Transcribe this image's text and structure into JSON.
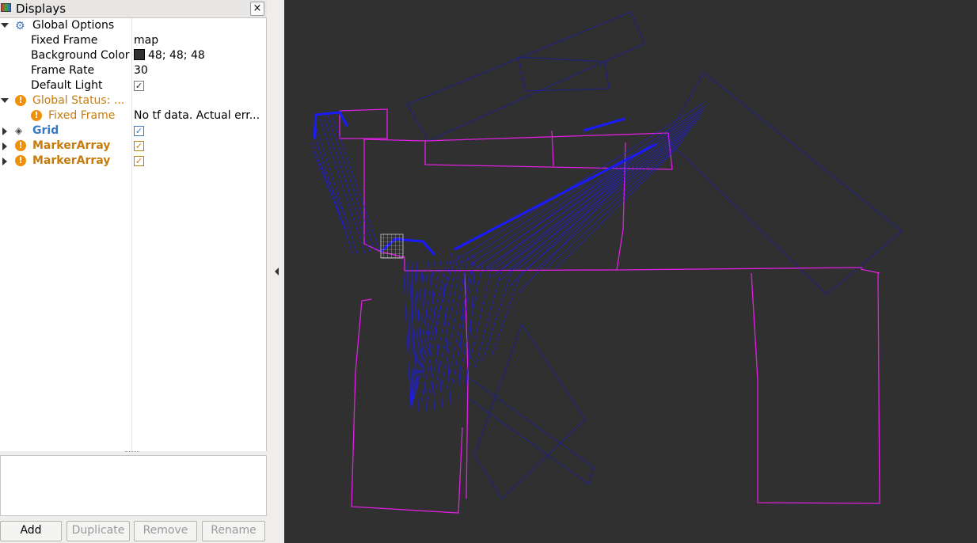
{
  "window": {
    "title": "Displays",
    "close_label": "×"
  },
  "tree": {
    "global_options": {
      "label": "Global Options",
      "icon": "gear-icon"
    },
    "fixed_frame": {
      "label": "Fixed Frame",
      "value": "map"
    },
    "background_color": {
      "label": "Background Color",
      "value": "48; 48; 48",
      "color": "#303030"
    },
    "frame_rate": {
      "label": "Frame Rate",
      "value": "30"
    },
    "default_light": {
      "label": "Default Light",
      "checked": "✓"
    },
    "global_status": {
      "label": "Global Status: ...",
      "icon": "warning-icon"
    },
    "status_fixed_frame": {
      "label": "Fixed Frame",
      "value": "No tf data.  Actual err..."
    },
    "grid": {
      "label": "Grid",
      "checked": "✓",
      "icon": "grid-icon"
    },
    "marker_array_1": {
      "label": "MarkerArray",
      "checked": "✓",
      "icon": "warning-icon"
    },
    "marker_array_2": {
      "label": "MarkerArray",
      "checked": "✓",
      "icon": "warning-icon"
    }
  },
  "buttons": {
    "add": "Add",
    "duplicate": "Duplicate",
    "remove": "Remove",
    "rename": "Rename"
  },
  "colors": {
    "viewport_bg": "#303030",
    "map_magenta": "#e020e0",
    "scan_blue": "#1a1aff",
    "warning": "#f0900a"
  }
}
